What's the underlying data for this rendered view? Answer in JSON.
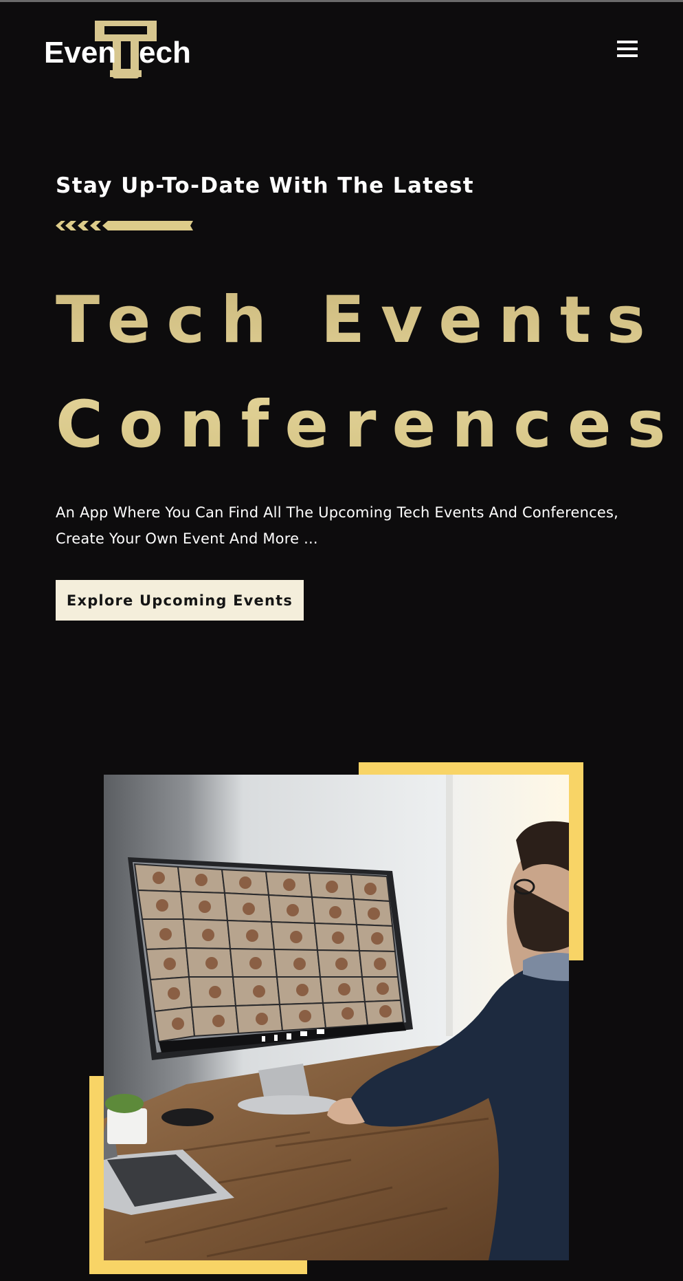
{
  "header": {
    "logo_text": "EvenTech",
    "logo_icon": "tech-letter-t-logo",
    "menu_icon": "hamburger-menu-icon"
  },
  "hero": {
    "tagline": "Stay Up-To-Date With The Latest",
    "divider_icon": "chevron-arrows-divider",
    "title_line_1": "Tech Events &",
    "title_line_2": "Conferences",
    "description": "An App Where You Can Find All The Upcoming Tech Events And Conferences, Create Your Own Event And More ...",
    "cta_label": "Explore Upcoming Events"
  },
  "illustration": {
    "subject": "man-at-desk-video-conference-photo"
  },
  "colors": {
    "background": "#0d0c0d",
    "gold": "#ddcc8a",
    "accent_yellow": "#f8d466",
    "button_bg": "#f4eedb",
    "button_text": "#151515",
    "text": "#ffffff"
  }
}
